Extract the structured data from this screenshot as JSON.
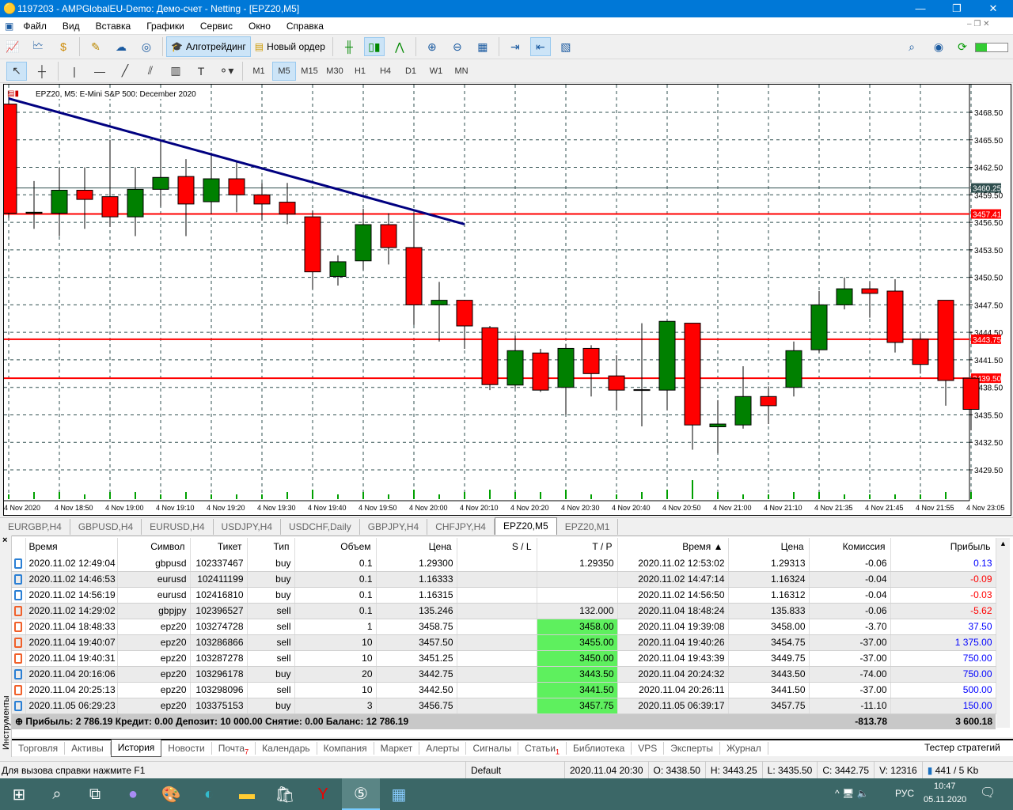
{
  "window": {
    "title": "1197203 - AMPGlobalEU-Demo: Демо-счет - Netting - [EPZ20,M5]",
    "minimize": "—",
    "restore": "❐",
    "close": "✕"
  },
  "menu": [
    "Файл",
    "Вид",
    "Вставка",
    "Графики",
    "Сервис",
    "Окно",
    "Справка"
  ],
  "toolbar": {
    "algo": "Алготрейдинг",
    "new_order": "Новый ордер"
  },
  "timeframes": [
    "M1",
    "M5",
    "M15",
    "M30",
    "H1",
    "H4",
    "D1",
    "W1",
    "MN"
  ],
  "active_timeframe": "M5",
  "chart_data": {
    "type": "candlestick",
    "title": "EPZ20, M5:  E-Mini S&P 500: December 2020",
    "ylim": [
      3427.5,
      3471.5
    ],
    "y_ticks": [
      "3468.50",
      "3465.50",
      "3462.50",
      "3459.50",
      "3456.50",
      "3453.50",
      "3450.50",
      "3447.50",
      "3444.50",
      "3441.50",
      "3438.50",
      "3435.50",
      "3432.50",
      "3429.50"
    ],
    "x_labels": [
      "4 Nov 2020",
      "4 Nov 18:50",
      "4 Nov 19:00",
      "4 Nov 19:10",
      "4 Nov 19:20",
      "4 Nov 19:30",
      "4 Nov 19:40",
      "4 Nov 19:50",
      "4 Nov 20:00",
      "4 Nov 20:10",
      "4 Nov 20:20",
      "4 Nov 20:30",
      "4 Nov 20:40",
      "4 Nov 20:50",
      "4 Nov 21:00",
      "4 Nov 21:10",
      "4 Nov 21:35",
      "4 Nov 21:45",
      "4 Nov 21:55",
      "4 Nov 23:05"
    ],
    "ohlc": [
      [
        3469.4,
        3470.2,
        3457.0,
        3457.5
      ],
      [
        3457.5,
        3461.0,
        3455.8,
        3457.6
      ],
      [
        3457.5,
        3462.5,
        3455.0,
        3460.0
      ],
      [
        3460.0,
        3462.5,
        3455.8,
        3459.0
      ],
      [
        3459.3,
        3465.5,
        3456.0,
        3457.1
      ],
      [
        3457.1,
        3462.5,
        3455.0,
        3460.1
      ],
      [
        3460.1,
        3465.5,
        3458.2,
        3461.4
      ],
      [
        3461.5,
        3463.4,
        3455.0,
        3458.5
      ],
      [
        3458.75,
        3464.1,
        3457.4,
        3461.25
      ],
      [
        3461.25,
        3463.1,
        3457.6,
        3459.5
      ],
      [
        3459.5,
        3460.8,
        3456.7,
        3458.5
      ],
      [
        3458.7,
        3460.8,
        3456.3,
        3457.4
      ],
      [
        3457.1,
        3457.8,
        3449.2,
        3451.1
      ],
      [
        3450.6,
        3452.9,
        3449.6,
        3452.2
      ],
      [
        3452.3,
        3458.0,
        3451.3,
        3456.25
      ],
      [
        3456.25,
        3457.5,
        3451.9,
        3453.75
      ],
      [
        3453.75,
        3457.5,
        3445.3,
        3447.5
      ],
      [
        3447.5,
        3450.0,
        3443.5,
        3448.0
      ],
      [
        3448.0,
        3448.0,
        3442.7,
        3445.2
      ],
      [
        3445.0,
        3445.2,
        3438.2,
        3438.8
      ],
      [
        3438.75,
        3444.2,
        3438.4,
        3442.5
      ],
      [
        3442.25,
        3442.7,
        3438.0,
        3438.2
      ],
      [
        3438.5,
        3443.25,
        3435.5,
        3442.75
      ],
      [
        3442.75,
        3443.1,
        3437.5,
        3440.0
      ],
      [
        3439.75,
        3442.0,
        3436.0,
        3438.2
      ],
      [
        3438.2,
        3445.5,
        3434.25,
        3438.25
      ],
      [
        3438.2,
        3445.7,
        3436.0,
        3445.7
      ],
      [
        3445.5,
        3445.5,
        3431.7,
        3434.4
      ],
      [
        3434.2,
        3437.1,
        3431.3,
        3434.5
      ],
      [
        3434.4,
        3440.8,
        3434.0,
        3437.5
      ],
      [
        3437.5,
        3438.6,
        3434.5,
        3436.5
      ],
      [
        3438.5,
        3443.5,
        3437.5,
        3442.5
      ],
      [
        3442.6,
        3449.0,
        3442.3,
        3447.5
      ],
      [
        3447.5,
        3450.5,
        3447.0,
        3449.25
      ],
      [
        3449.25,
        3450.0,
        3446.1,
        3448.75
      ],
      [
        3449.0,
        3450.3,
        3442.3,
        3443.4
      ],
      [
        3443.75,
        3444.4,
        3440.0,
        3441.0
      ],
      [
        3448.0,
        3448.0,
        3436.5,
        3439.25
      ],
      [
        3439.5,
        3439.5,
        3433.8,
        3436.1
      ]
    ],
    "volumes": [
      2,
      3,
      3,
      2,
      3,
      3,
      2,
      3,
      2,
      2,
      2,
      3,
      4,
      2,
      3,
      2,
      4,
      2,
      3,
      4,
      3,
      3,
      4,
      2,
      2,
      3,
      4,
      8,
      3,
      2,
      2,
      3,
      3,
      2,
      2,
      2,
      2,
      3,
      3
    ],
    "trendline": {
      "from": [
        0,
        3470.0
      ],
      "to": [
        18,
        3456.3
      ],
      "color": "#000080"
    },
    "levels": [
      {
        "price": 3460.25,
        "label": "3460.25",
        "color": "#2f4f4f"
      },
      {
        "price": 3457.41,
        "label": "3457.41",
        "color": "#ff0000"
      },
      {
        "price": 3443.75,
        "label": "3443.75",
        "color": "#ff0000"
      },
      {
        "price": 3439.5,
        "label": "3439.50",
        "color": "#ff0000"
      }
    ]
  },
  "chart_tabs": [
    "EURGBP,H4",
    "GBPUSD,H4",
    "EURUSD,H4",
    "USDJPY,H4",
    "USDCHF,Daily",
    "GBPJPY,H4",
    "CHFJPY,H4",
    "EPZ20,M5",
    "EPZ20,M1"
  ],
  "active_chart_tab": "EPZ20,M5",
  "toolbox": {
    "close": "×",
    "label": "Инструменты",
    "columns": [
      "Время",
      "Символ",
      "Тикет",
      "Тип",
      "Объем",
      "Цена",
      "S / L",
      "T / P",
      "Время ▲",
      "Цена",
      "Комиссия",
      "Прибыль"
    ],
    "rows": [
      [
        "2020.11.02 12:49:04",
        "gbpusd",
        "102337467",
        "buy",
        "0.1",
        "1.29300",
        "",
        "1.29350",
        "2020.11.02 12:53:02",
        "1.29313",
        "-0.06",
        "0.13"
      ],
      [
        "2020.11.02 14:46:53",
        "eurusd",
        "102411199",
        "buy",
        "0.1",
        "1.16333",
        "",
        "",
        "2020.11.02 14:47:14",
        "1.16324",
        "-0.04",
        "-0.09"
      ],
      [
        "2020.11.02 14:56:19",
        "eurusd",
        "102416810",
        "buy",
        "0.1",
        "1.16315",
        "",
        "",
        "2020.11.02 14:56:50",
        "1.16312",
        "-0.04",
        "-0.03"
      ],
      [
        "2020.11.02 14:29:02",
        "gbpjpy",
        "102396527",
        "sell",
        "0.1",
        "135.246",
        "",
        "132.000",
        "2020.11.04 18:48:24",
        "135.833",
        "-0.06",
        "-5.62"
      ],
      [
        "2020.11.04 18:48:33",
        "epz20",
        "103274728",
        "sell",
        "1",
        "3458.75",
        "",
        "3458.00",
        "2020.11.04 19:39:08",
        "3458.00",
        "-3.70",
        "37.50"
      ],
      [
        "2020.11.04 19:40:07",
        "epz20",
        "103286866",
        "sell",
        "10",
        "3457.50",
        "",
        "3455.00",
        "2020.11.04 19:40:26",
        "3454.75",
        "-37.00",
        "1 375.00"
      ],
      [
        "2020.11.04 19:40:31",
        "epz20",
        "103287278",
        "sell",
        "10",
        "3451.25",
        "",
        "3450.00",
        "2020.11.04 19:43:39",
        "3449.75",
        "-37.00",
        "750.00"
      ],
      [
        "2020.11.04 20:16:06",
        "epz20",
        "103296178",
        "buy",
        "20",
        "3442.75",
        "",
        "3443.50",
        "2020.11.04 20:24:32",
        "3443.50",
        "-74.00",
        "750.00"
      ],
      [
        "2020.11.04 20:25:13",
        "epz20",
        "103298096",
        "sell",
        "10",
        "3442.50",
        "",
        "3441.50",
        "2020.11.04 20:26:11",
        "3441.50",
        "-37.00",
        "500.00"
      ],
      [
        "2020.11.05 06:29:23",
        "epz20",
        "103375153",
        "buy",
        "3",
        "3456.75",
        "",
        "3457.75",
        "2020.11.05 06:39:17",
        "3457.75",
        "-11.10",
        "150.00"
      ]
    ],
    "tp_hit": [
      false,
      false,
      false,
      false,
      true,
      true,
      true,
      true,
      true,
      true
    ],
    "summary": {
      "text": "Прибыль: 2 786.19  Кредит: 0.00  Депозит: 10 000.00  Снятие: 0.00  Баланс: 12 786.19",
      "commission": "-813.78",
      "profit": "3 600.18"
    }
  },
  "bottom_tabs": [
    {
      "label": "Торговля"
    },
    {
      "label": "Активы"
    },
    {
      "label": "История"
    },
    {
      "label": "Новости"
    },
    {
      "label": "Почта",
      "badge": "7"
    },
    {
      "label": "Календарь"
    },
    {
      "label": "Компания"
    },
    {
      "label": "Маркет"
    },
    {
      "label": "Алерты"
    },
    {
      "label": "Сигналы"
    },
    {
      "label": "Статьи",
      "badge": "1"
    },
    {
      "label": "Библиотека"
    },
    {
      "label": "VPS"
    },
    {
      "label": "Эксперты"
    },
    {
      "label": "Журнал"
    }
  ],
  "active_bottom_tab": "История",
  "strategy_tester": "Тестер стратегий",
  "status": {
    "help": "Для вызова справки нажмите F1",
    "profile": "Default",
    "time": "2020.11.04 20:30",
    "o": "O: 3438.50",
    "h": "H: 3443.25",
    "l": "L: 3435.50",
    "c": "C: 3442.75",
    "v": "V: 12316",
    "traffic": "441 / 5 Kb"
  },
  "taskbar": {
    "lang": "РУС",
    "time": "10:47",
    "date": "05.11.2020"
  }
}
